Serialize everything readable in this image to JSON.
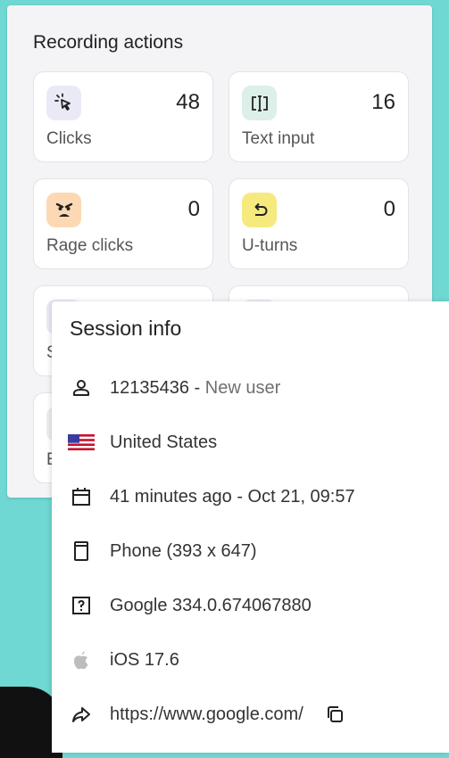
{
  "recording_actions": {
    "title": "Recording actions",
    "cards": [
      {
        "label": "Clicks",
        "count": "48",
        "icon": "pointer-click-icon",
        "icon_bg": "#eaeaf7"
      },
      {
        "label": "Text input",
        "count": "16",
        "icon": "text-cursor-icon",
        "icon_bg": "#dcefe9"
      },
      {
        "label": "Rage clicks",
        "count": "0",
        "icon": "angry-face-icon",
        "icon_bg": "#fcd9b4"
      },
      {
        "label": "U-turns",
        "count": "0",
        "icon": "u-turn-icon",
        "icon_bg": "#f6ea7e"
      }
    ],
    "partial_labels": [
      "S",
      "E"
    ]
  },
  "session_info": {
    "title": "Session info",
    "user_id": "12135436",
    "user_sep": " - ",
    "user_status": "New user",
    "country": "United States",
    "time": "41 minutes ago - Oct 21, 09:57",
    "device": "Phone (393 x 647)",
    "browser": "Google 334.0.674067880",
    "os": "iOS 17.6",
    "referrer": "https://www.google.com/"
  },
  "colors": {
    "background": "#6fd8d2",
    "panel": "#f4f4f6",
    "card": "#ffffff"
  }
}
